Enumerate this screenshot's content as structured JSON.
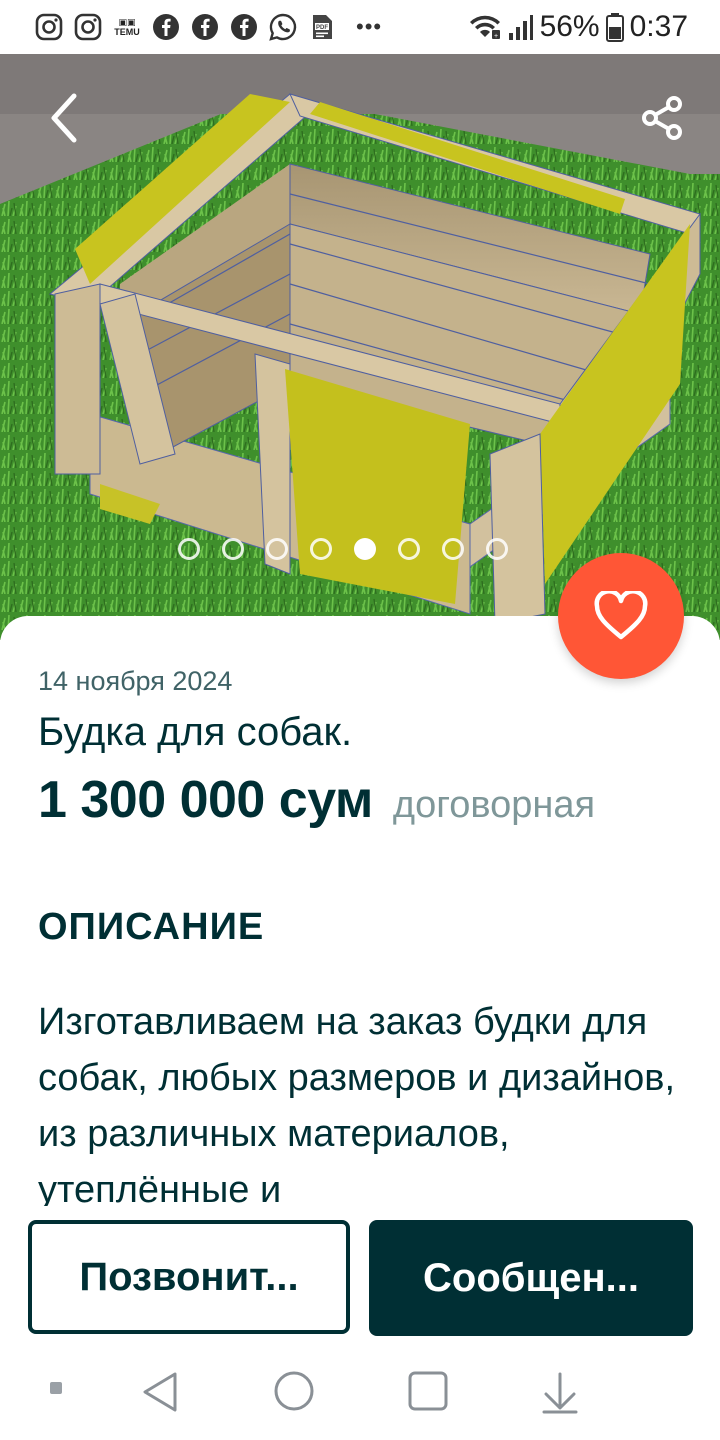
{
  "status_bar": {
    "icons": [
      "instagram-icon",
      "instagram-icon",
      "temu-icon",
      "facebook-icon",
      "facebook-icon",
      "facebook-icon",
      "whatsapp-icon",
      "pdf-icon"
    ],
    "temu_label": "TEMU",
    "more": "•••",
    "battery": "56%",
    "time": "0:37"
  },
  "gallery": {
    "image_count": 8,
    "active_index": 4
  },
  "listing": {
    "date": "14 ноября 2024",
    "title": "Будка для собак.",
    "price": "1 300 000 сум",
    "price_note": "договорная"
  },
  "description": {
    "heading": "ОПИСАНИЕ",
    "text": "Изготавливаем на заказ будки для собак, любых размеров и дизайнов, из различных материалов, утеплённые и"
  },
  "actions": {
    "call_label": "Позвонит...",
    "message_label": "Сообщен..."
  },
  "colors": {
    "primary": "#002f34",
    "favorite": "#ff5636",
    "muted": "#7f9799"
  }
}
